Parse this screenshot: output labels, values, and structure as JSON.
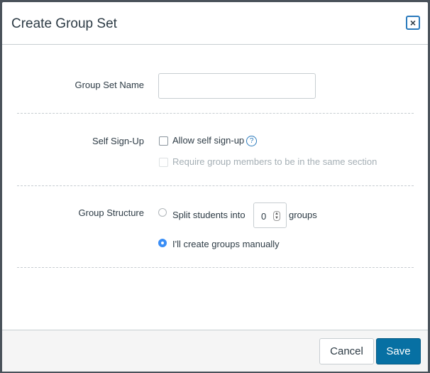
{
  "dialog": {
    "title": "Create Group Set",
    "close_icon": "×"
  },
  "form": {
    "group_set_name": {
      "label": "Group Set Name",
      "value": "",
      "placeholder": ""
    },
    "self_signup": {
      "label": "Self Sign-Up",
      "allow_label": "Allow self sign-up",
      "allow_checked": false,
      "help_icon": "?",
      "require_section_label": "Require group members to be in the same section",
      "require_section_checked": false,
      "require_section_disabled": true
    },
    "group_structure": {
      "label": "Group Structure",
      "split_prefix": "Split students into",
      "split_count": "0",
      "split_suffix": "groups",
      "manual_label": "I'll create groups manually",
      "selected": "manual"
    }
  },
  "footer": {
    "cancel_label": "Cancel",
    "save_label": "Save"
  }
}
